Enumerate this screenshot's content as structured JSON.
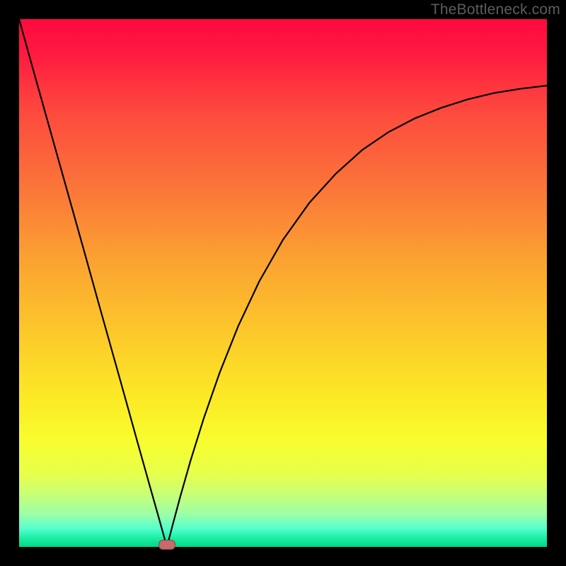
{
  "watermark": {
    "text": "TheBottleneck.com"
  },
  "colors": {
    "gradient_stops": [
      {
        "offset": 0.0,
        "color": "#ff0a3e"
      },
      {
        "offset": 0.06,
        "color": "#ff1840"
      },
      {
        "offset": 0.18,
        "color": "#fd4b3e"
      },
      {
        "offset": 0.3,
        "color": "#fb6f3a"
      },
      {
        "offset": 0.45,
        "color": "#fba032"
      },
      {
        "offset": 0.6,
        "color": "#fcca2a"
      },
      {
        "offset": 0.72,
        "color": "#fcea26"
      },
      {
        "offset": 0.8,
        "color": "#f8fd2e"
      },
      {
        "offset": 0.86,
        "color": "#e8ff4a"
      },
      {
        "offset": 0.9,
        "color": "#c8ff76"
      },
      {
        "offset": 0.94,
        "color": "#98ffaa"
      },
      {
        "offset": 0.965,
        "color": "#55ffcf"
      },
      {
        "offset": 0.985,
        "color": "#16eca0"
      },
      {
        "offset": 1.0,
        "color": "#05d688"
      }
    ],
    "curve": "#000000",
    "marker_fill": "#c66a6a",
    "marker_stroke": "#8e4747"
  },
  "chart_data": {
    "type": "line",
    "title": "",
    "xlabel": "",
    "ylabel": "",
    "xlim": [
      0,
      100
    ],
    "ylim": [
      0,
      100
    ],
    "series": [
      {
        "name": "left-branch",
        "x": [
          0.0,
          2.5,
          5.0,
          7.5,
          10.0,
          12.5,
          15.0,
          17.5,
          20.0,
          22.5,
          25.0,
          26.5,
          27.5,
          28.0
        ],
        "values": [
          100.0,
          91.0,
          82.1,
          73.2,
          64.3,
          55.4,
          46.4,
          37.5,
          28.6,
          19.6,
          10.7,
          5.4,
          1.8,
          0.0
        ]
      },
      {
        "name": "right-branch",
        "x": [
          28.0,
          29.0,
          30.5,
          32.5,
          35.0,
          38.0,
          41.5,
          45.5,
          50.0,
          55.0,
          60.0,
          65.0,
          70.0,
          75.0,
          80.0,
          85.0,
          90.0,
          95.0,
          100.0
        ],
        "values": [
          0.0,
          3.8,
          9.4,
          16.4,
          24.4,
          33.0,
          41.8,
          50.3,
          58.2,
          65.2,
          70.7,
          75.2,
          78.6,
          81.2,
          83.2,
          84.8,
          86.0,
          86.8,
          87.4
        ]
      }
    ],
    "marker": {
      "x": 28.0,
      "y": 0.4
    }
  }
}
